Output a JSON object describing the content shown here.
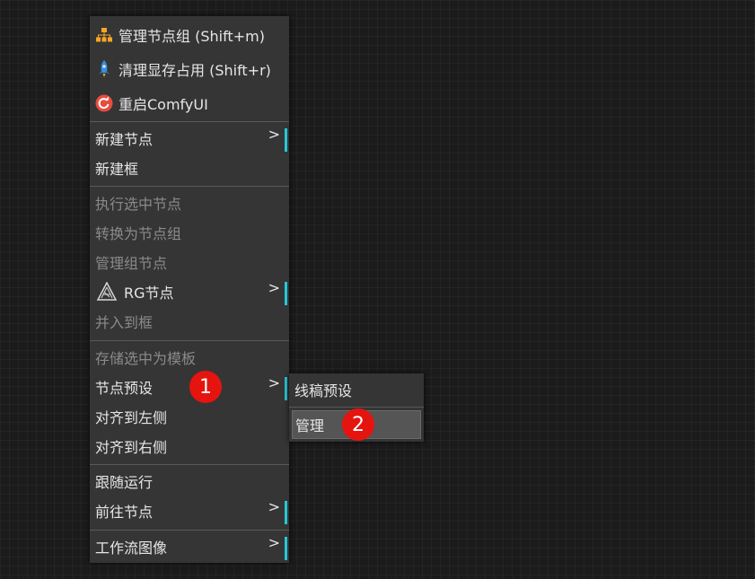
{
  "context_menu": {
    "items": [
      {
        "label": "管理节点组 (Shift+m)",
        "icon": "org-chart-icon",
        "disabled": false
      },
      {
        "label": "清理显存占用 (Shift+r)",
        "icon": "rocket-icon",
        "disabled": false
      },
      {
        "label": "重启ComfyUI",
        "icon": "restart-icon",
        "disabled": false
      },
      {
        "label": "新建节点",
        "submenu": true,
        "disabled": false
      },
      {
        "label": "新建框",
        "disabled": false
      },
      {
        "label": "执行选中节点",
        "disabled": true
      },
      {
        "label": "转换为节点组",
        "disabled": true
      },
      {
        "label": "管理组节点",
        "disabled": true
      },
      {
        "label": "RG节点",
        "icon": "rg-logo-icon",
        "submenu": true,
        "disabled": false
      },
      {
        "label": "并入到框",
        "disabled": true
      },
      {
        "label": "存储选中为模板",
        "disabled": true
      },
      {
        "label": "节点预设",
        "submenu": true,
        "disabled": false
      },
      {
        "label": "对齐到左侧",
        "disabled": false
      },
      {
        "label": "对齐到右侧",
        "disabled": false
      },
      {
        "label": "跟随运行",
        "disabled": false
      },
      {
        "label": "前往节点",
        "submenu": true,
        "disabled": false
      },
      {
        "label": "工作流图像",
        "submenu": true,
        "disabled": false
      }
    ],
    "submenu_arrow": ">"
  },
  "submenu": {
    "items": [
      {
        "label": "线稿预设"
      },
      {
        "label": "管理",
        "hovered": true
      }
    ]
  },
  "annotations": [
    {
      "label": "1"
    },
    {
      "label": "2"
    }
  ],
  "colors": {
    "background": "#1b1b1b",
    "menu_bg": "#353535",
    "accent": "#27c7d6",
    "badge": "#e6140f",
    "icon_orange": "#f5a623",
    "icon_blue": "#3a8fd8",
    "icon_red": "#e84c3d"
  }
}
